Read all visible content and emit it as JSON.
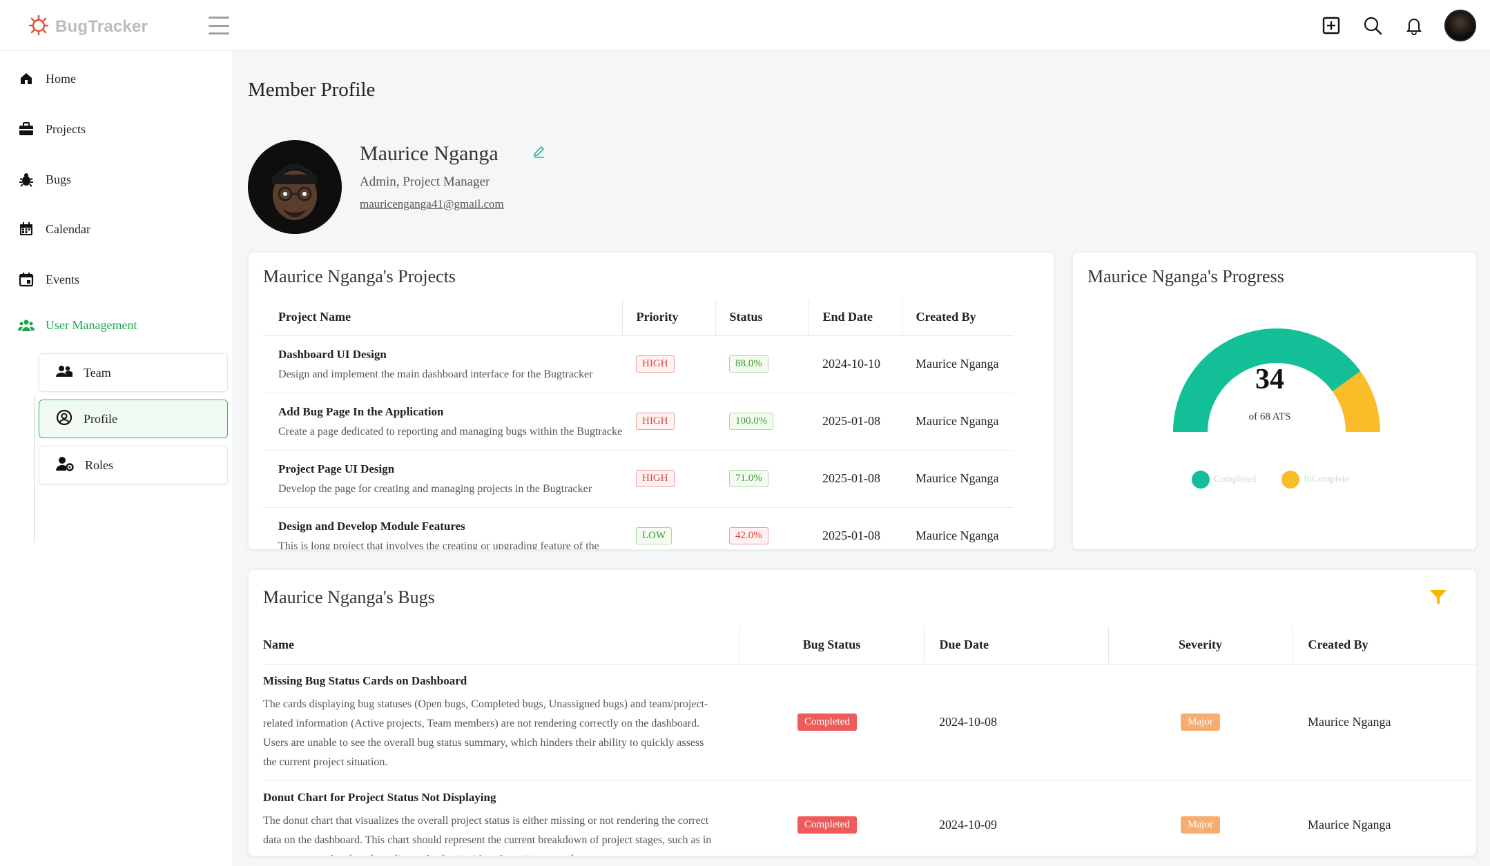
{
  "app": {
    "name": "BugTracker"
  },
  "sidebar": {
    "items": [
      {
        "label": "Home"
      },
      {
        "label": "Projects"
      },
      {
        "label": "Bugs"
      },
      {
        "label": "Calendar"
      },
      {
        "label": "Events"
      }
    ],
    "user_management": {
      "label": "User Management",
      "sub": [
        {
          "label": "Team"
        },
        {
          "label": "Profile"
        },
        {
          "label": "Roles"
        }
      ]
    }
  },
  "page": {
    "title": "Member Profile"
  },
  "profile": {
    "name": "Maurice Nganga",
    "role": "Admin, Project Manager",
    "email": "mauricenganga41@gmail.com"
  },
  "projects": {
    "title": "Maurice Nganga's Projects",
    "headers": [
      "Project Name",
      "Priority",
      "Status",
      "End Date",
      "Created By"
    ],
    "rows": [
      {
        "name": "Dashboard UI Design",
        "desc": "Design and implement the main dashboard interface for the Bugtracker",
        "priority": "HIGH",
        "status": "88.0%",
        "end": "2024-10-10",
        "by": "Maurice Nganga"
      },
      {
        "name": "Add Bug Page In the Application",
        "desc": "Create a page dedicated to reporting and managing bugs within the Bugtracker",
        "priority": "HIGH",
        "status": "100.0%",
        "end": "2025-01-08",
        "by": "Maurice Nganga"
      },
      {
        "name": "Project Page UI Design",
        "desc": "Develop the page for creating and managing projects in the Bugtracker",
        "priority": "HIGH",
        "status": "71.0%",
        "end": "2025-01-08",
        "by": "Maurice Nganga"
      },
      {
        "name": "Design and Develop Module Features",
        "desc": "This is long project that involves the creating or upgrading feature of the",
        "priority": "LOW",
        "status": "42.0%",
        "end": "2025-01-08",
        "by": "Maurice Nganga"
      }
    ]
  },
  "progress": {
    "title": "Maurice Nganga's Progress",
    "value": "34",
    "caption": "of 68 ATS",
    "completed_fraction": 0.8,
    "legend": [
      {
        "label": "Completed",
        "color": "#13bf96"
      },
      {
        "label": "InComplete",
        "color": "#fbbc2a"
      }
    ]
  },
  "bugs": {
    "title": "Maurice Nganga's Bugs",
    "headers": [
      "Name",
      "Bug Status",
      "Due Date",
      "Severity",
      "Created By"
    ],
    "rows": [
      {
        "name": "Missing Bug Status Cards on Dashboard",
        "desc": "The cards displaying bug statuses (Open bugs, Completed bugs, Unassigned bugs) and team/project-related information (Active projects, Team members) are not rendering correctly on the dashboard. Users are unable to see the overall bug status summary, which hinders their ability to quickly assess the current project situation.",
        "status": "Completed",
        "due": "2024-10-08",
        "severity": "Major",
        "by": "Maurice Nganga"
      },
      {
        "name": "Donut Chart for Project Status Not Displaying",
        "desc": "The donut chart that visualizes the overall project status is either missing or not rendering the correct data on the dashboard. This chart should represent the current breakdown of project stages, such as in progress, completed, and pending tasks, but it either shows incorrect data or",
        "status": "Completed",
        "due": "2024-10-09",
        "severity": "Major",
        "by": "Maurice Nganga"
      }
    ]
  },
  "colors": {
    "accent_green": "#18a84a",
    "gauge_teal": "#13bf96",
    "gauge_yellow": "#fbbc2a",
    "filter_yellow": "#f7b500"
  }
}
